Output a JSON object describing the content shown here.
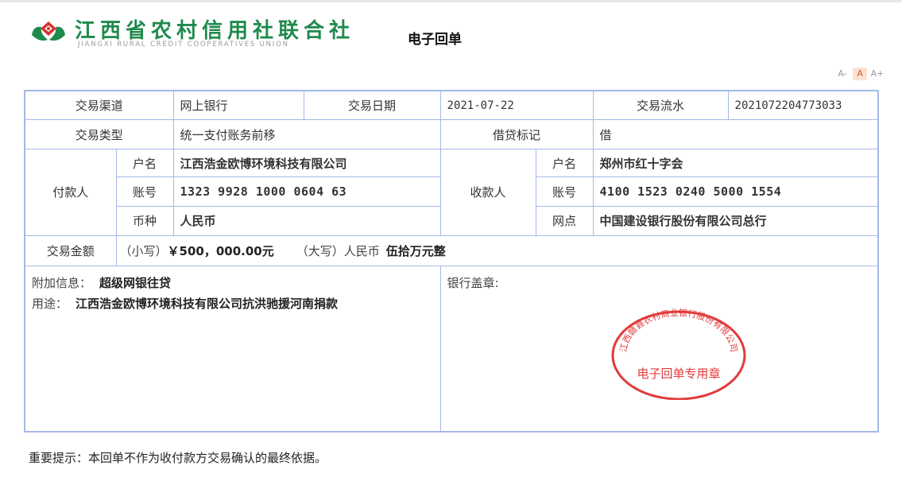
{
  "header": {
    "org_name_cn": "江西省农村信用社联合社",
    "org_name_en": "JIANGXI RURAL CREDIT COOPERATIVES UNION",
    "doc_title": "电子回单",
    "font_tools": [
      "A-",
      "A",
      "A+"
    ]
  },
  "receipt": {
    "channel_label": "交易渠道",
    "channel_value": "网上银行",
    "date_label": "交易日期",
    "date_value": "2021-07-22",
    "serial_label": "交易流水",
    "serial_value": "2021072204773033",
    "type_label": "交易类型",
    "type_value": "统一支付账务前移",
    "dc_label": "借贷标记",
    "dc_value": "借",
    "payer_label": "付款人",
    "payee_label": "收款人",
    "name_label": "户名",
    "account_label": "账号",
    "currency_label": "币种",
    "branch_label": "网点",
    "payer_name": "江西浩金欧博环境科技有限公司",
    "payer_account": "1323 9928 1000 0604 63",
    "payer_currency": "人民币",
    "payee_name": "郑州市红十字会",
    "payee_account": "4100 1523 0240 5000 1554",
    "payee_branch": "中国建设银行股份有限公司总行",
    "amount_label": "交易金额",
    "amount_small_label": "（小写）",
    "amount_small_value": "￥500，000.00元",
    "amount_big_label": "（大写）人民币",
    "amount_big_value": "伍拾万元整",
    "extra_label": "附加信息：",
    "extra_value": "超级网银往贷",
    "purpose_label": "用途：",
    "purpose_value": "江西浩金欧博环境科技有限公司抗洪驰援河南捐款",
    "seal_label": "银行盖章:",
    "stamp_arc_text": "江西赣县农村商业银行股份有限公司",
    "stamp_center_text": "电子回单专用章"
  },
  "footer": {
    "notice": "重要提示：本回单不作为收付款方交易确认的最终依据。"
  },
  "colors": {
    "brand_green": "#1f8a4c",
    "brand_red": "#d7322f",
    "table_border": "#a5b8e6",
    "stamp_red": "#e23a3a",
    "active_font_tool": "#e0552b"
  }
}
